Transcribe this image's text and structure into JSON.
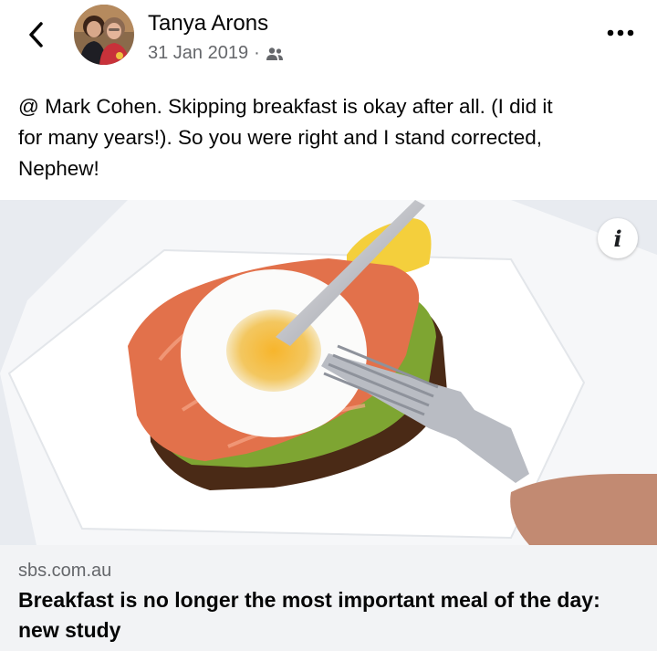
{
  "post": {
    "author": "Tanya Arons",
    "date": "31 Jan 2019",
    "separator": "·",
    "audience_icon": "friends-icon",
    "text": "@ Mark Cohen. Skipping breakfast is okay after all.  (I did it\nfor many years!). So you were right and I stand corrected,\nNephew!"
  },
  "icons": {
    "back": "chevron-left-icon",
    "more": "more-horizontal-icon",
    "info": "info-icon"
  },
  "link": {
    "info_glyph": "i",
    "domain": "sbs.com.au",
    "title": "Breakfast is no longer the most important meal of the day: new study"
  },
  "colors": {
    "text_primary": "#050505",
    "text_secondary": "#65676b",
    "card_bg": "#f2f3f5"
  }
}
